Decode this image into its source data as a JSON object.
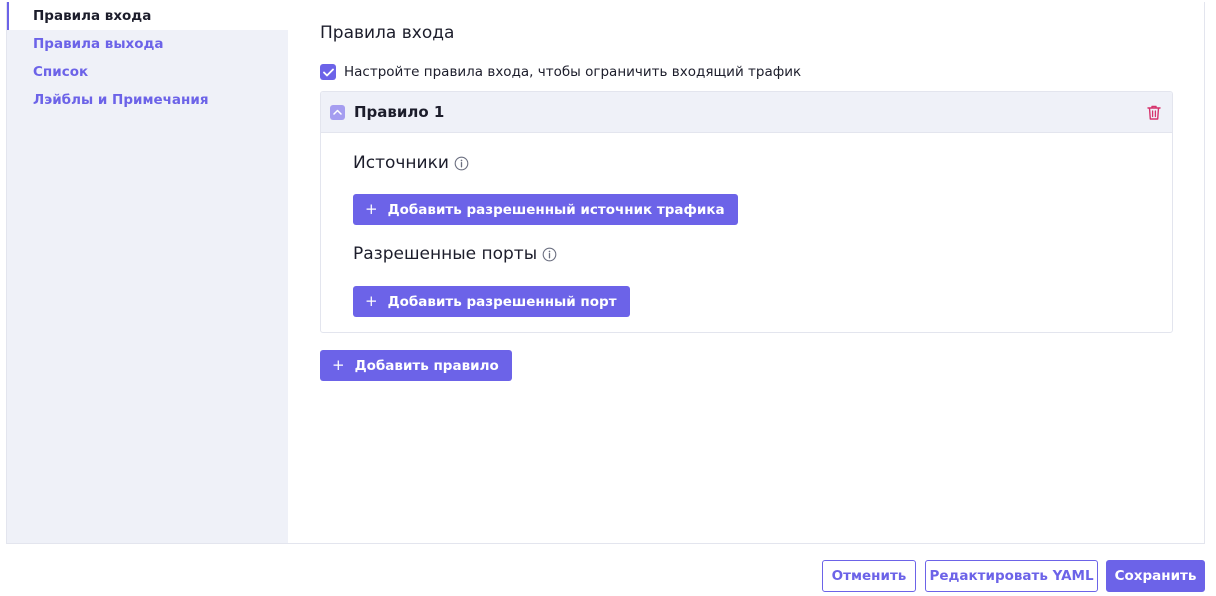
{
  "sidebar": {
    "items": [
      {
        "label": "Правила входа",
        "active": true
      },
      {
        "label": "Правила выхода",
        "active": false
      },
      {
        "label": "Список",
        "active": false
      },
      {
        "label": "Лэйблы и Примечания",
        "active": false
      }
    ]
  },
  "main": {
    "title": "Правила входа",
    "ingress_checkbox": {
      "checked": true,
      "label": "Настройте правила входа, чтобы ограничить входящий трафик"
    },
    "rule": {
      "title": "Правило 1",
      "sources": {
        "title": "Источники",
        "add_button": "Добавить разрешенный источник трафика"
      },
      "ports": {
        "title": "Разрешенные порты",
        "add_button": "Добавить разрешенный порт"
      }
    },
    "add_rule_button": "Добавить правило"
  },
  "footer": {
    "cancel_label": "Отменить",
    "edit_yaml_label": "Редактировать YAML",
    "save_label": "Сохранить"
  },
  "icons": {
    "plus": "+",
    "collapse": "chevron-up-icon",
    "delete": "trash-icon",
    "info": "info-icon",
    "check": "check-icon"
  },
  "colors": {
    "accent": "#6c63e8",
    "sidebar_bg": "#eff1f8",
    "danger": "#d6336c",
    "border": "#e3e5ee"
  }
}
